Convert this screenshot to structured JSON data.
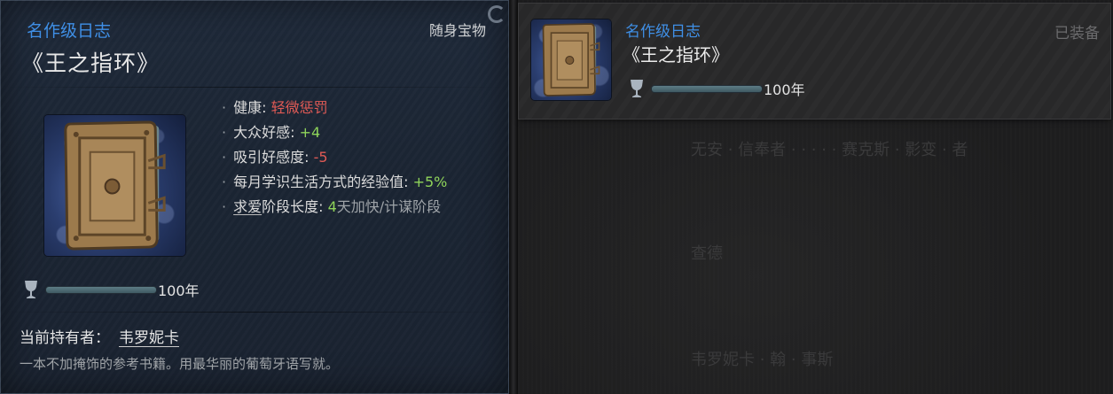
{
  "tooltip": {
    "category": "名作级日志",
    "item_type": "随身宝物",
    "title": "《王之指环》",
    "stats": [
      {
        "label": "健康: ",
        "value": "轻微惩罚",
        "value_color": "neg"
      },
      {
        "label": "大众好感: ",
        "value": "+4",
        "value_color": "pos"
      },
      {
        "label": "吸引好感度: ",
        "value": "-5",
        "value_color": "neg"
      },
      {
        "label": "每月学识生活方式的经验值: ",
        "value": "+5%",
        "value_color": "pos"
      },
      {
        "label_link": "求爱",
        "label": "阶段长度: ",
        "value": "4",
        "suffix": "天加快/计谋阶段"
      }
    ],
    "durability": {
      "icon": "goblet-icon",
      "text": "100年",
      "fill": 1.0
    },
    "owner_label": "当前持有者：",
    "owner_name": "韦罗妮卡",
    "flavor": "一本不加掩饰的参考书籍。用最华丽的葡萄牙语写就。"
  },
  "equipped_card": {
    "category": "名作级日志",
    "title": "《王之指环》",
    "status": "已装备",
    "durability": {
      "icon": "goblet-icon",
      "text": "100年",
      "fill": 1.0
    }
  },
  "colors": {
    "category_blue": "#3f8fe6",
    "negative_red": "#e05a55",
    "positive_green": "#8fd45a"
  }
}
